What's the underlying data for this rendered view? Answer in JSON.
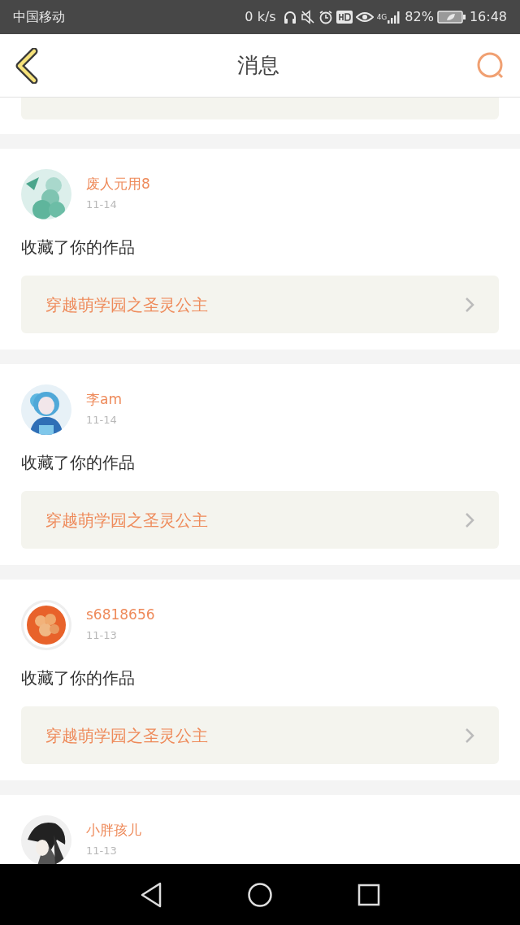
{
  "status_bar": {
    "carrier": "中国移动",
    "speed": "0 k/s",
    "network": "4G",
    "battery_percent": "82%",
    "time": "16:48"
  },
  "header": {
    "title": "消息"
  },
  "messages": [
    {
      "user": "废人元用8",
      "date": "11-14",
      "text": "收藏了你的作品",
      "work": "穿越萌学园之圣灵公主"
    },
    {
      "user": "李am",
      "date": "11-14",
      "text": "收藏了你的作品",
      "work": "穿越萌学园之圣灵公主"
    },
    {
      "user": "s6818656",
      "date": "11-13",
      "text": "收藏了你的作品",
      "work": "穿越萌学园之圣灵公主"
    },
    {
      "user": "小胖孩儿",
      "date": "11-13"
    }
  ]
}
